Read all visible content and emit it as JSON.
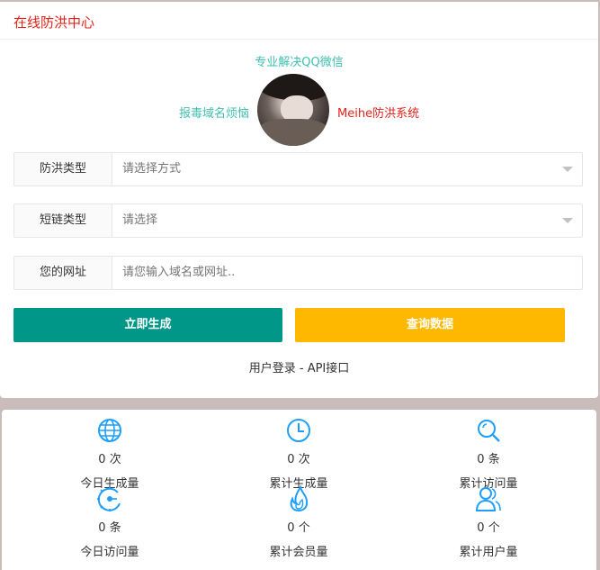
{
  "header": {
    "title": "在线防洪中心"
  },
  "promo": {
    "top_tag": "专业解决QQ微信",
    "left_tag": "报毒域名烦恼",
    "right_tag": "Meihe防洪系统"
  },
  "form": {
    "rows": [
      {
        "label": "防洪类型",
        "value": "请选择方式",
        "kind": "select"
      },
      {
        "label": "短链类型",
        "value": "请选择",
        "kind": "select"
      },
      {
        "label": "您的网址",
        "placeholder": "请您输入域名或网址..",
        "kind": "input"
      }
    ],
    "generate_label": "立即生成",
    "query_label": "查询数据",
    "links_text": "用户登录 - API接口"
  },
  "stats": [
    {
      "icon": "globe-icon",
      "count": "0 次",
      "label": "今日生成量"
    },
    {
      "icon": "clock-icon",
      "count": "0 次",
      "label": "累计生成量"
    },
    {
      "icon": "search-icon",
      "count": "0 条",
      "label": "累计访问量"
    },
    {
      "icon": "gear-icon",
      "count": "0 条",
      "label": "今日访问量"
    },
    {
      "icon": "fire-icon",
      "count": "0 个",
      "label": "累计会员量"
    },
    {
      "icon": "users-icon",
      "count": "0 个",
      "label": "累计用户量"
    }
  ],
  "colors": {
    "header_title": "#e2231a",
    "teal_accent": "#3fbfb1",
    "generate_button": "#009688",
    "query_button": "#ffb800",
    "icon_blue": "#1e9fff"
  }
}
